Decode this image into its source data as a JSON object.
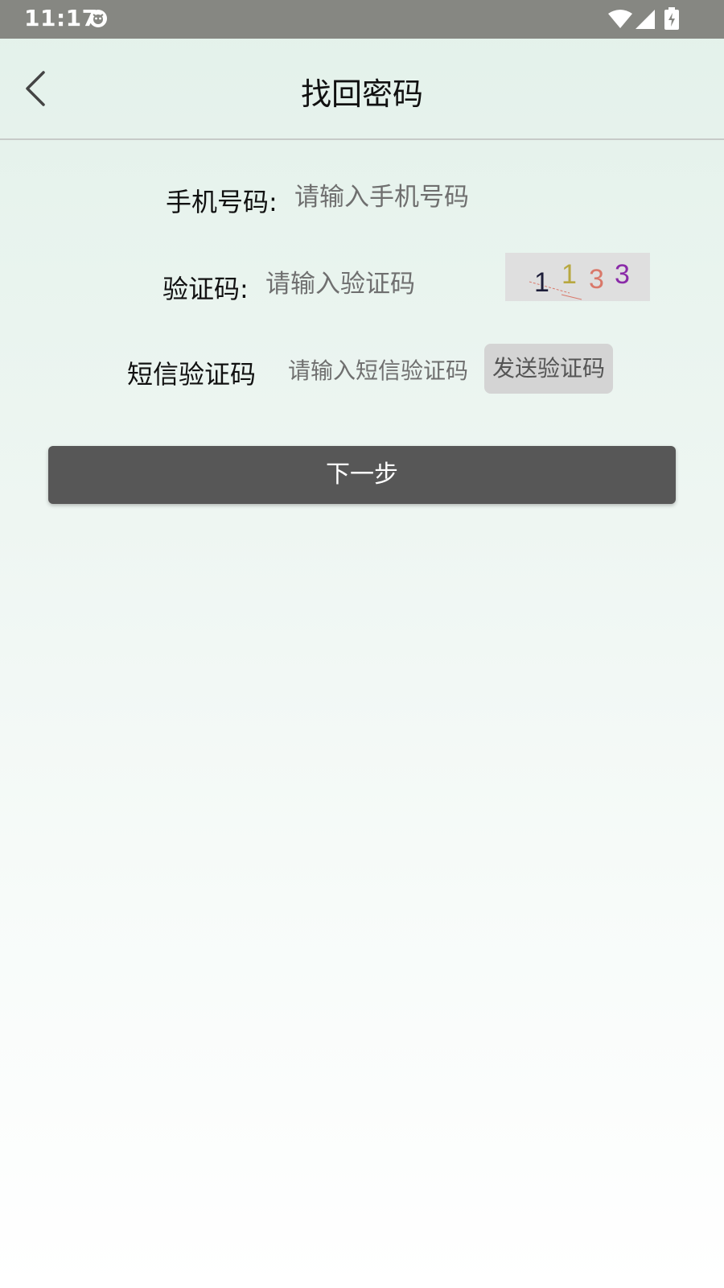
{
  "status_bar": {
    "time": "11:17",
    "icons": [
      "app-notification-icon",
      "wifi-icon",
      "cell-signal-icon",
      "battery-charging-icon"
    ]
  },
  "header": {
    "title": "找回密码",
    "back_icon": "chevron-left-icon"
  },
  "form": {
    "phone": {
      "label": "手机号码:",
      "placeholder": "请输入手机号码",
      "value": ""
    },
    "captcha": {
      "label": "验证码:",
      "placeholder": "请输入验证码",
      "value": "",
      "image_chars": [
        {
          "char": "1",
          "color": "#1e1e3a"
        },
        {
          "char": "1",
          "color": "#b8a840"
        },
        {
          "char": "3",
          "color": "#d9786a"
        },
        {
          "char": "3",
          "color": "#8a2aa8"
        }
      ]
    },
    "sms": {
      "label": "短信验证码",
      "placeholder": "请输入短信验证码",
      "value": "",
      "send_button": "发送验证码"
    },
    "next_button": "下一步"
  },
  "colors": {
    "status_bar": "#868782",
    "button_dark": "#575757",
    "button_light": "#d4d4d4"
  }
}
